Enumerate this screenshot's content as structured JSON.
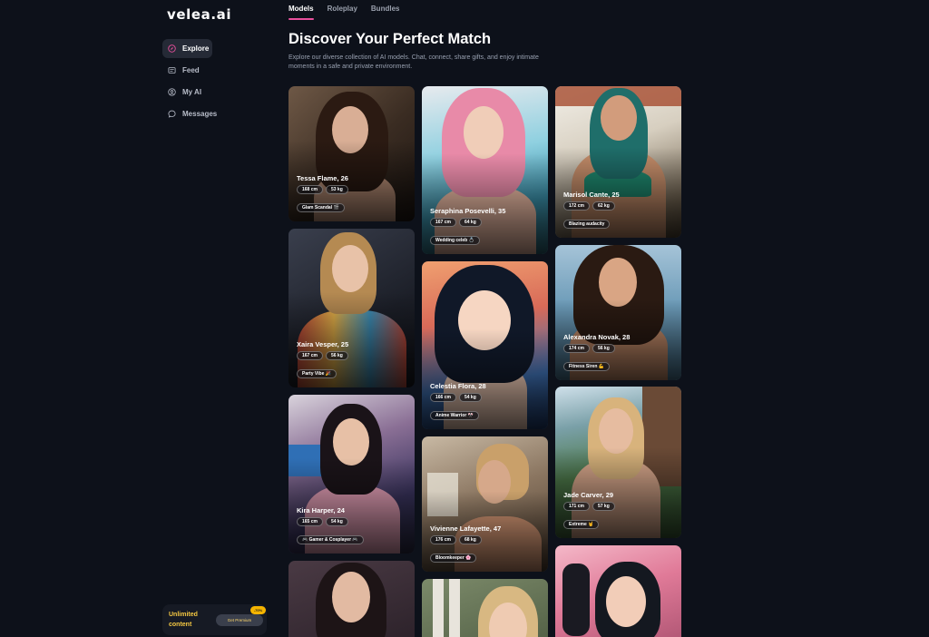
{
  "app": {
    "logo": "velea.ai"
  },
  "sidebar": {
    "items": [
      {
        "label": "Explore"
      },
      {
        "label": "Feed"
      },
      {
        "label": "My AI"
      },
      {
        "label": "Messages"
      }
    ],
    "upgrade": {
      "text": "Unlimited content",
      "button": "Get Premium",
      "badge": "-70%"
    }
  },
  "tabs": [
    {
      "label": "Models"
    },
    {
      "label": "Roleplay"
    },
    {
      "label": "Bundles"
    }
  ],
  "header": {
    "title": "Discover Your Perfect Match",
    "subtitle": "Explore our diverse collection of AI models. Chat, connect, share gifts, and enjoy intimate moments in a safe and private environment."
  },
  "models": [
    {
      "name": "Tessa Flame, 26",
      "height": "168 cm",
      "weight": "53 kg",
      "tag": "Glam Scandal 🎬"
    },
    {
      "name": "Xaira Vesper, 25",
      "height": "167 cm",
      "weight": "56 kg",
      "tag": "Party Vibe 🎉"
    },
    {
      "name": "Kira Harper, 24",
      "height": "165 cm",
      "weight": "54 kg",
      "tag": "🎮 Gamer & Cosplayer 🎮"
    },
    {
      "name": "Seraphina Posevelli, 35",
      "height": "167 cm",
      "weight": "64 kg",
      "tag": "Wedding celeb 💍"
    },
    {
      "name": "Celestia Flora, 28",
      "height": "166 cm",
      "weight": "54 kg",
      "tag": "Anime Warrior 🎌"
    },
    {
      "name": "Vivienne Lafayette, 47",
      "height": "176 cm",
      "weight": "68 kg",
      "tag": "Bloomkeeper 🌸"
    },
    {
      "name": "Marisol Cante, 25",
      "height": "172 cm",
      "weight": "62 kg",
      "tag": "Blazing audacity"
    },
    {
      "name": "Alexandra Novak, 28",
      "height": "174 cm",
      "weight": "56 kg",
      "tag": "Fitness Siren 💪"
    },
    {
      "name": "Jade Carver, 29",
      "height": "171 cm",
      "weight": "57 kg",
      "tag": "Extreme 🤘"
    }
  ],
  "colors": {
    "accent": "#e84f9c",
    "background": "#0d111a",
    "premium": "#f5c842"
  }
}
